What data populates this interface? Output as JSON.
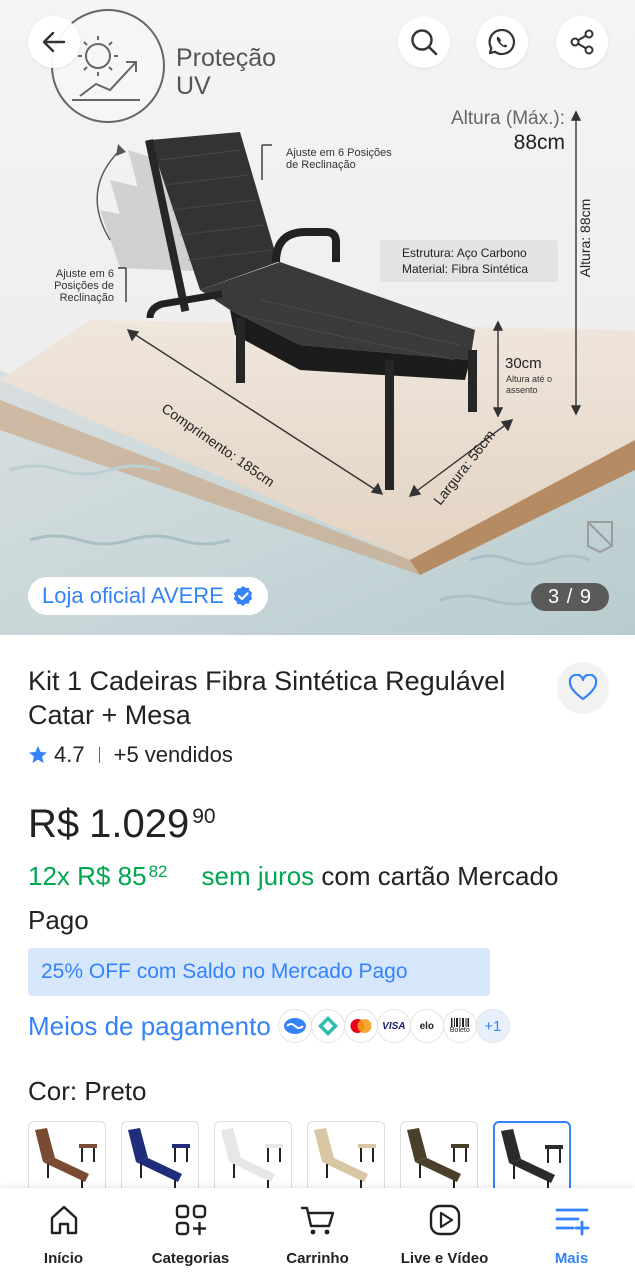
{
  "gallery": {
    "counter": "3 / 9",
    "store_badge": "Loja oficial AVERE",
    "image_text": {
      "uv_title": "Proteção UV",
      "height_max_label": "Altura (Máx.):",
      "height_max_value": "88cm",
      "recline_top": "Ajuste em 6 Posições de Reclinação",
      "recline_left": "Ajuste em 6 Posições de Reclinação",
      "spec_structure": "Estrutura: Aço Carbono",
      "spec_material": "Material: Fibra Sintética",
      "height_rotated": "Altura: 88cm",
      "seat_height_value": "30cm",
      "seat_height_sub": "Altura até o assento",
      "length_label": "Comprimento: 185cm",
      "width_label": "Largura: 56cm"
    }
  },
  "product": {
    "title": "Kit 1 Cadeiras Fibra Sintética Regulável Catar + Mesa",
    "rating": "4.7",
    "sold": "+5 vendidos",
    "price_currency": "R$",
    "price_main": "1.029",
    "price_cents": "90",
    "inst_count": "12x",
    "inst_currency": "R$",
    "inst_main": "85",
    "inst_cents": "82",
    "inst_interest": "sem juros",
    "inst_rest": "com cartão Mercado Pago",
    "discount_banner": "25% OFF com Saldo no Mercado Pago",
    "payment_link": "Meios de pagamento",
    "payment_more": "+1",
    "payment_elo": "elo",
    "payment_visa": "VISA",
    "payment_boleto": "Boleto",
    "color_label": "Cor: Preto",
    "swatch_colors": [
      "#7a4a32",
      "#1f2d7a",
      "#e6e6e6",
      "#d9c7a3",
      "#4a3f2a",
      "#2b2b2b"
    ],
    "selected_swatch": 5
  },
  "nav": {
    "items": [
      {
        "label": "Início",
        "icon": "home-icon"
      },
      {
        "label": "Categorias",
        "icon": "categories-icon"
      },
      {
        "label": "Carrinho",
        "icon": "cart-icon"
      },
      {
        "label": "Live e Vídeo",
        "icon": "play-icon"
      },
      {
        "label": "Mais",
        "icon": "menu-plus-icon"
      }
    ],
    "active_index": 4
  },
  "colors": {
    "brand_blue": "#3483fa",
    "green": "#00a650",
    "banner_bg": "#d6e6fb"
  }
}
